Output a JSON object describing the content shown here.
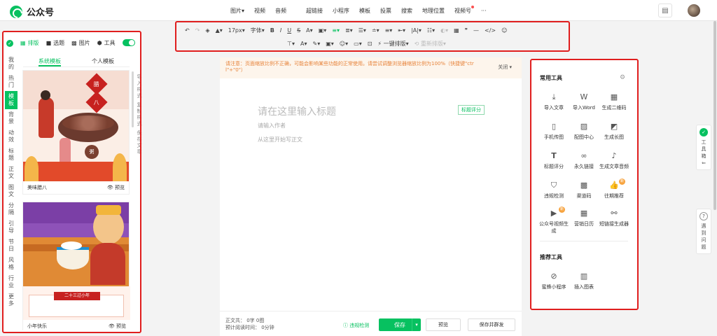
{
  "app": {
    "logo_text": "公众号"
  },
  "topnav": {
    "group1": [
      "图片▾",
      "视频",
      "音频"
    ],
    "group2": [
      "超链接",
      "小程序",
      "模板",
      "投票",
      "搜索",
      "地理位置",
      "视频号"
    ],
    "more": "···"
  },
  "toolbar": {
    "row1": [
      "↶",
      "↷",
      "◈",
      "▲▾",
      "17px▾",
      "字体▾",
      "B",
      "I",
      "U",
      "S",
      "A▾",
      "▣▾",
      "≡▾",
      "≣▾",
      "☰▾",
      "≐▾",
      "≡▾",
      "⇤▾",
      "|A|▾",
      "☷▾",
      "◐▾",
      "▦",
      "❞",
      "—",
      "</>",
      "☺"
    ],
    "row2_icons": [
      "⊤▾",
      "A▾",
      "✎▾",
      "▣▾",
      "☺▾",
      "▭▾",
      "⊡"
    ],
    "one_click": "一键排版▾",
    "restore": "重新排版▾"
  },
  "leftpanel": {
    "tabs": [
      {
        "icon": "▦",
        "label": "排版"
      },
      {
        "icon": "■",
        "label": "选题"
      },
      {
        "icon": "▩",
        "label": "图片"
      },
      {
        "icon": "⬢",
        "label": "工具"
      }
    ],
    "categories": [
      "我的",
      "热门",
      "模板",
      "背景",
      "动效",
      "标题",
      "正文",
      "图文",
      "分隔",
      "引导",
      "节日",
      "风格",
      "行业",
      "更多"
    ],
    "subtabs": [
      "系统模板",
      "个人模板"
    ],
    "side_labels": [
      "导入样式",
      "复制样式",
      "保存文章"
    ],
    "cards": [
      {
        "title": "美味腊八",
        "preview": "预览",
        "poster_char1": "腊",
        "poster_char2": "八",
        "bowl_char": "粥"
      },
      {
        "title": "小年快乐",
        "preview": "预览",
        "banner": "二十三过小年"
      }
    ]
  },
  "editor": {
    "notice": "请注意：页面缩放比例不正确，可能会影响某些功能的正常使用。请尝试调整浏览器缩放比例为100%（快捷键\"ctr l\"+\"0\"）",
    "notice_close": "关闭 ▾",
    "title_placeholder": "请在这里输入标题",
    "title_score": "标题评分",
    "author_placeholder": "请输入作者",
    "body_placeholder": "从这里开始写正文",
    "stats_line1": "正文共： 0字 0图",
    "stats_line2": "预计阅读时间： 0分钟",
    "violation_check": "违规检测",
    "save": "保存",
    "preview": "预览",
    "save_send": "保存并群发"
  },
  "rightpanel": {
    "common_title": "常用工具",
    "recommend_title": "推荐工具",
    "common_tools": [
      {
        "icon": "⤓",
        "label": "导入文章"
      },
      {
        "icon": "W",
        "label": "导入Word"
      },
      {
        "icon": "▦",
        "label": "生成二维码"
      },
      {
        "icon": "▯",
        "label": "手机传图"
      },
      {
        "icon": "▨",
        "label": "配图中心"
      },
      {
        "icon": "◩",
        "label": "生成长图"
      },
      {
        "icon": "T",
        "label": "标题评分"
      },
      {
        "icon": "∞",
        "label": "永久链接"
      },
      {
        "icon": "♪",
        "label": "生成文章音频"
      },
      {
        "icon": "⛉",
        "label": "违规检测"
      },
      {
        "icon": "▩",
        "label": "渠道码"
      },
      {
        "icon": "👍",
        "label": "往期推荐"
      },
      {
        "icon": "▶",
        "label": "公众号视频生成"
      },
      {
        "icon": "▦",
        "label": "营销日历"
      },
      {
        "icon": "⚯",
        "label": "短链接生成器"
      }
    ],
    "recommend_tools": [
      {
        "icon": "⊘",
        "label": "蜜蜂小程序"
      },
      {
        "icon": "▥",
        "label": "插入图表"
      }
    ]
  },
  "float": {
    "toolbox": "工具箱",
    "help": "遇到问题"
  }
}
